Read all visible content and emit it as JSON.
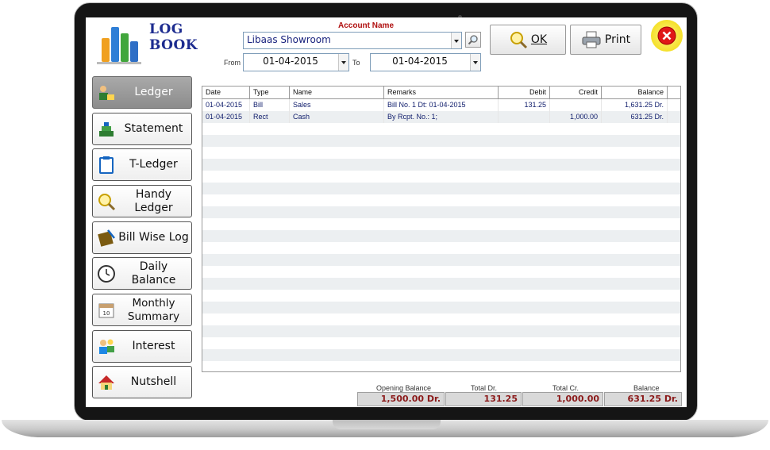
{
  "app": {
    "title_line1": "LOG",
    "title_line2": "BOOK"
  },
  "header": {
    "account_label": "Account Name",
    "account_value": "Libaas Showroom",
    "from_label": "From",
    "from_value": "01-04-2015",
    "to_label": "To",
    "to_value": "01-04-2015",
    "ok_label": "OK",
    "print_label": "Print"
  },
  "sidebar": {
    "items": [
      {
        "label": "Ledger",
        "active": true
      },
      {
        "label": "Statement"
      },
      {
        "label": "T-Ledger"
      },
      {
        "label": "Handy Ledger"
      },
      {
        "label": "Bill Wise Log"
      },
      {
        "label": "Daily Balance"
      },
      {
        "label": "Monthly",
        "label2": "Summary"
      },
      {
        "label": "Interest"
      },
      {
        "label": "Nutshell"
      }
    ]
  },
  "table": {
    "columns": [
      "Date",
      "Type",
      "Name",
      "Remarks",
      "Debit",
      "Credit",
      "Balance"
    ],
    "rows": [
      [
        "01-04-2015",
        "Bill",
        "Sales",
        "Bill No. 1 Dt: 01-04-2015",
        "131.25",
        "",
        "1,631.25 Dr."
      ],
      [
        "01-04-2015",
        "Rect",
        "Cash",
        "By Rcpt. No.: 1;",
        "",
        "1,000.00",
        "631.25 Dr."
      ]
    ]
  },
  "footer": {
    "opening_balance_label": "Opening Balance",
    "opening_balance_value": "1,500.00 Dr.",
    "total_dr_label": "Total Dr.",
    "total_dr_value": "131.25",
    "total_cr_label": "Total Cr.",
    "total_cr_value": "1,000.00",
    "balance_label": "Balance",
    "balance_value": "631.25 Dr."
  },
  "colors": {
    "accent_blue": "#1c2b8f",
    "label_red": "#b01010",
    "value_red": "#8b1a1a",
    "row_stripe": "#eceff1"
  }
}
